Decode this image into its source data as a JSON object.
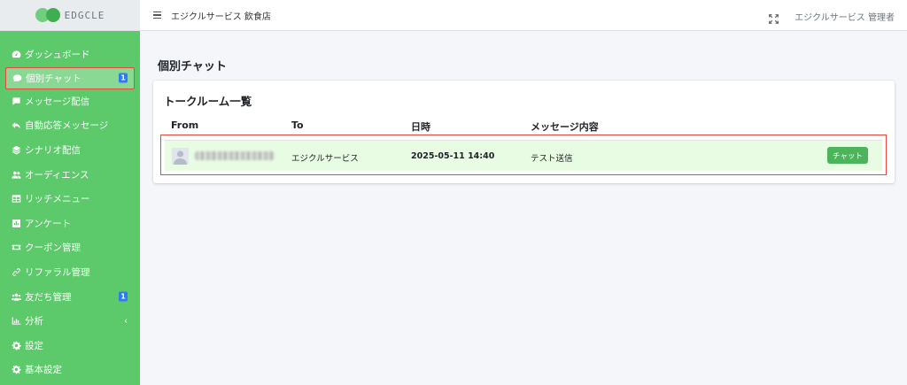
{
  "brand": {
    "name": "EDGCLE"
  },
  "header": {
    "title": "エジクルサービス 飲食店",
    "user": "エジクルサービス 管理者"
  },
  "sidebar": {
    "items": [
      {
        "label": "ダッシュボード",
        "icon": "gauge-icon"
      },
      {
        "label": "個別チャット",
        "icon": "chat-bubble-icon",
        "badge": "1",
        "active": true
      },
      {
        "label": "メッセージ配信",
        "icon": "message-icon"
      },
      {
        "label": "自動応答メッセージ",
        "icon": "reply-icon"
      },
      {
        "label": "シナリオ配信",
        "icon": "layers-icon"
      },
      {
        "label": "オーディエンス",
        "icon": "users-icon"
      },
      {
        "label": "リッチメニュー",
        "icon": "table-icon"
      },
      {
        "label": "アンケート",
        "icon": "poll-icon"
      },
      {
        "label": "クーポン管理",
        "icon": "ticket-icon"
      },
      {
        "label": "リファラル管理",
        "icon": "link-icon"
      },
      {
        "label": "友だち管理",
        "icon": "friends-icon",
        "badge": "1"
      },
      {
        "label": "分析",
        "icon": "chart-icon",
        "chevron": "‹"
      },
      {
        "label": "設定",
        "icon": "gear-icon"
      },
      {
        "label": "基本設定",
        "icon": "gear-icon"
      }
    ]
  },
  "main": {
    "page_title": "個別チャット",
    "card_title": "トークルーム一覧",
    "columns": [
      "From",
      "To",
      "日時",
      "メッセージ内容"
    ],
    "rows": [
      {
        "to": "エジクルサービス",
        "datetime": "2025-05-11 14:40",
        "message": "テスト送信",
        "action": "チャット"
      }
    ]
  },
  "colors": {
    "sidebar": "#5cc96b",
    "badge": "#2f7bf5",
    "button": "#4cb55b",
    "highlight_row": "#e8fbe3",
    "annotation": "#e24b3b"
  }
}
